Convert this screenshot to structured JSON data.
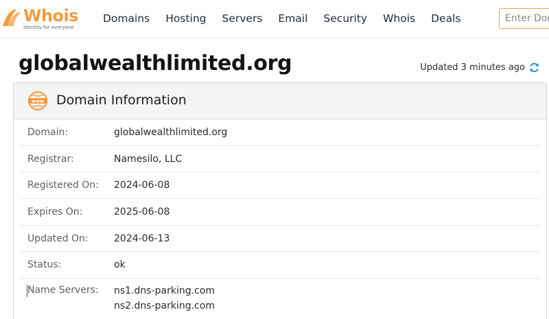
{
  "header": {
    "logo_text": "Whois",
    "logo_tagline": "Identity for everyone",
    "nav": [
      "Domains",
      "Hosting",
      "Servers",
      "Email",
      "Security",
      "Whois",
      "Deals"
    ],
    "search_placeholder": "Enter Domain"
  },
  "page": {
    "title": "globalwealthlimited.org",
    "updated": "Updated 3 minutes ago"
  },
  "card": {
    "title": "Domain Information",
    "rows": [
      {
        "label": "Domain:",
        "value": "globalwealthlimited.org"
      },
      {
        "label": "Registrar:",
        "value": "Namesilo, LLC"
      },
      {
        "label": "Registered On:",
        "value": "2024-06-08"
      },
      {
        "label": "Expires On:",
        "value": "2025-06-08"
      },
      {
        "label": "Updated On:",
        "value": "2024-06-13"
      },
      {
        "label": "Status:",
        "value": "ok"
      }
    ],
    "name_servers_label": "Name Servers:",
    "name_servers": [
      "ns1.dns-parking.com",
      "ns2.dns-parking.com"
    ]
  },
  "colors": {
    "brand": "#f39c3d",
    "accent_blue": "#2a8ad8"
  },
  "icons": {
    "logo": "whois-logo-icon",
    "refresh": "refresh-icon",
    "www": "www-globe-icon"
  }
}
